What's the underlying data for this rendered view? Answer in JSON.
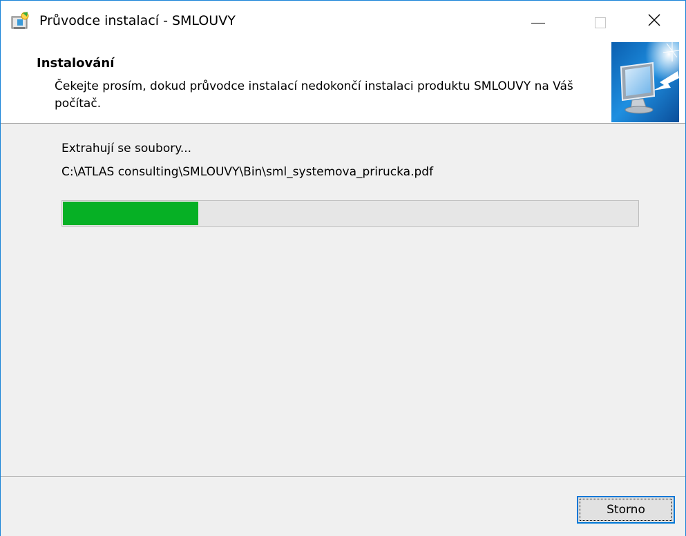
{
  "window": {
    "title": "Průvodce instalací - SMLOUVY",
    "accent_color": "#1883d7",
    "icons": {
      "app": "installer-icon",
      "minimize": "minimize-icon",
      "maximize": "maximize-icon",
      "close": "close-icon"
    },
    "close_glyph": "✕"
  },
  "header": {
    "title": "Instalování",
    "description": "Čekejte prosím, dokud průvodce instalací nedokončí instalaci produktu SMLOUVY na Váš počítač.",
    "image_icon": "monitor-install-icon"
  },
  "body": {
    "status_text": "Extrahují se soubory...",
    "current_file": "C:\\ATLAS consulting\\SMLOUVY\\Bin\\sml_systemova_prirucka.pdf",
    "progress_fraction": 0.235,
    "progress_color": "#06b025"
  },
  "footer": {
    "cancel_label": "Storno"
  }
}
